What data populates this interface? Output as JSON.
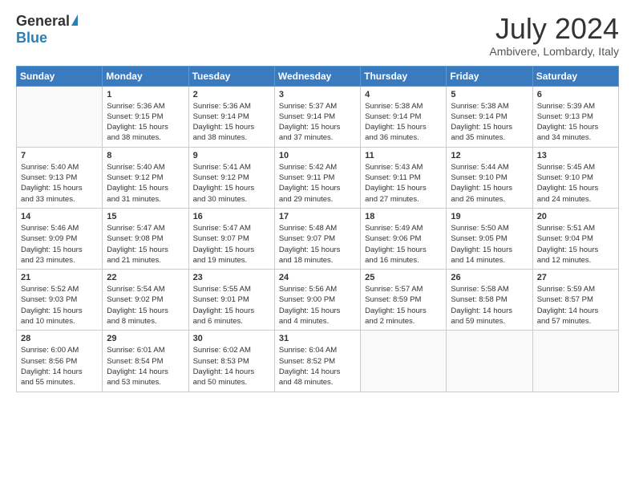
{
  "logo": {
    "general": "General",
    "blue": "Blue"
  },
  "title": {
    "month_year": "July 2024",
    "location": "Ambivere, Lombardy, Italy"
  },
  "headers": [
    "Sunday",
    "Monday",
    "Tuesday",
    "Wednesday",
    "Thursday",
    "Friday",
    "Saturday"
  ],
  "weeks": [
    [
      {
        "num": "",
        "info": ""
      },
      {
        "num": "1",
        "info": "Sunrise: 5:36 AM\nSunset: 9:15 PM\nDaylight: 15 hours\nand 38 minutes."
      },
      {
        "num": "2",
        "info": "Sunrise: 5:36 AM\nSunset: 9:14 PM\nDaylight: 15 hours\nand 38 minutes."
      },
      {
        "num": "3",
        "info": "Sunrise: 5:37 AM\nSunset: 9:14 PM\nDaylight: 15 hours\nand 37 minutes."
      },
      {
        "num": "4",
        "info": "Sunrise: 5:38 AM\nSunset: 9:14 PM\nDaylight: 15 hours\nand 36 minutes."
      },
      {
        "num": "5",
        "info": "Sunrise: 5:38 AM\nSunset: 9:14 PM\nDaylight: 15 hours\nand 35 minutes."
      },
      {
        "num": "6",
        "info": "Sunrise: 5:39 AM\nSunset: 9:13 PM\nDaylight: 15 hours\nand 34 minutes."
      }
    ],
    [
      {
        "num": "7",
        "info": "Sunrise: 5:40 AM\nSunset: 9:13 PM\nDaylight: 15 hours\nand 33 minutes."
      },
      {
        "num": "8",
        "info": "Sunrise: 5:40 AM\nSunset: 9:12 PM\nDaylight: 15 hours\nand 31 minutes."
      },
      {
        "num": "9",
        "info": "Sunrise: 5:41 AM\nSunset: 9:12 PM\nDaylight: 15 hours\nand 30 minutes."
      },
      {
        "num": "10",
        "info": "Sunrise: 5:42 AM\nSunset: 9:11 PM\nDaylight: 15 hours\nand 29 minutes."
      },
      {
        "num": "11",
        "info": "Sunrise: 5:43 AM\nSunset: 9:11 PM\nDaylight: 15 hours\nand 27 minutes."
      },
      {
        "num": "12",
        "info": "Sunrise: 5:44 AM\nSunset: 9:10 PM\nDaylight: 15 hours\nand 26 minutes."
      },
      {
        "num": "13",
        "info": "Sunrise: 5:45 AM\nSunset: 9:10 PM\nDaylight: 15 hours\nand 24 minutes."
      }
    ],
    [
      {
        "num": "14",
        "info": "Sunrise: 5:46 AM\nSunset: 9:09 PM\nDaylight: 15 hours\nand 23 minutes."
      },
      {
        "num": "15",
        "info": "Sunrise: 5:47 AM\nSunset: 9:08 PM\nDaylight: 15 hours\nand 21 minutes."
      },
      {
        "num": "16",
        "info": "Sunrise: 5:47 AM\nSunset: 9:07 PM\nDaylight: 15 hours\nand 19 minutes."
      },
      {
        "num": "17",
        "info": "Sunrise: 5:48 AM\nSunset: 9:07 PM\nDaylight: 15 hours\nand 18 minutes."
      },
      {
        "num": "18",
        "info": "Sunrise: 5:49 AM\nSunset: 9:06 PM\nDaylight: 15 hours\nand 16 minutes."
      },
      {
        "num": "19",
        "info": "Sunrise: 5:50 AM\nSunset: 9:05 PM\nDaylight: 15 hours\nand 14 minutes."
      },
      {
        "num": "20",
        "info": "Sunrise: 5:51 AM\nSunset: 9:04 PM\nDaylight: 15 hours\nand 12 minutes."
      }
    ],
    [
      {
        "num": "21",
        "info": "Sunrise: 5:52 AM\nSunset: 9:03 PM\nDaylight: 15 hours\nand 10 minutes."
      },
      {
        "num": "22",
        "info": "Sunrise: 5:54 AM\nSunset: 9:02 PM\nDaylight: 15 hours\nand 8 minutes."
      },
      {
        "num": "23",
        "info": "Sunrise: 5:55 AM\nSunset: 9:01 PM\nDaylight: 15 hours\nand 6 minutes."
      },
      {
        "num": "24",
        "info": "Sunrise: 5:56 AM\nSunset: 9:00 PM\nDaylight: 15 hours\nand 4 minutes."
      },
      {
        "num": "25",
        "info": "Sunrise: 5:57 AM\nSunset: 8:59 PM\nDaylight: 15 hours\nand 2 minutes."
      },
      {
        "num": "26",
        "info": "Sunrise: 5:58 AM\nSunset: 8:58 PM\nDaylight: 14 hours\nand 59 minutes."
      },
      {
        "num": "27",
        "info": "Sunrise: 5:59 AM\nSunset: 8:57 PM\nDaylight: 14 hours\nand 57 minutes."
      }
    ],
    [
      {
        "num": "28",
        "info": "Sunrise: 6:00 AM\nSunset: 8:56 PM\nDaylight: 14 hours\nand 55 minutes."
      },
      {
        "num": "29",
        "info": "Sunrise: 6:01 AM\nSunset: 8:54 PM\nDaylight: 14 hours\nand 53 minutes."
      },
      {
        "num": "30",
        "info": "Sunrise: 6:02 AM\nSunset: 8:53 PM\nDaylight: 14 hours\nand 50 minutes."
      },
      {
        "num": "31",
        "info": "Sunrise: 6:04 AM\nSunset: 8:52 PM\nDaylight: 14 hours\nand 48 minutes."
      },
      {
        "num": "",
        "info": ""
      },
      {
        "num": "",
        "info": ""
      },
      {
        "num": "",
        "info": ""
      }
    ]
  ]
}
